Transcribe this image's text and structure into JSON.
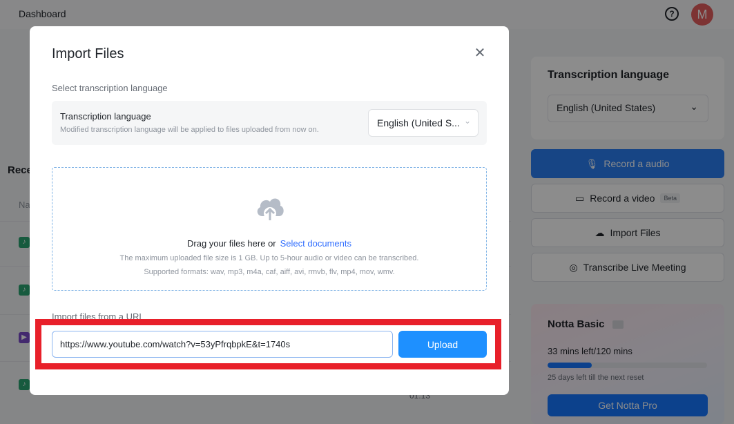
{
  "topbar": {
    "title": "Dashboard",
    "help_icon": "question-circle-icon",
    "avatar_initial": "M",
    "avatar_color": "#e35d5d"
  },
  "recent": {
    "title": "Rece",
    "column_name": "Na",
    "file_icons": [
      "audio-file-icon",
      "audio-file-icon",
      "video-file-icon",
      "audio-file-icon"
    ],
    "partial_duration": "01:13"
  },
  "sidebar": {
    "language_card": {
      "title": "Transcription language",
      "selected": "English (United States)"
    },
    "actions": [
      {
        "label": "Record a audio",
        "icon": "microphone-icon",
        "primary": true
      },
      {
        "label": "Record a video",
        "icon": "video-camera-icon",
        "badge": "Beta"
      },
      {
        "label": "Import Files",
        "icon": "cloud-upload-icon"
      },
      {
        "label": "Transcribe Live Meeting",
        "icon": "meeting-icon"
      }
    ],
    "plan": {
      "title": "Notta Basic",
      "usage_text": "33 mins left/120 mins",
      "usage_fraction": 0.275,
      "reset_text": "25 days left till the next reset",
      "cta": "Get Notta Pro"
    }
  },
  "modal": {
    "title": "Import Files",
    "close_icon": "close-icon",
    "language_section_label": "Select transcription language",
    "language_panel": {
      "title": "Transcription language",
      "description": "Modified transcription language will be applied to files uploaded from now on.",
      "selected": "English (United S..."
    },
    "dropzone": {
      "icon": "cloud-upload-icon",
      "drag_text": "Drag your files here or",
      "select_link": "Select documents",
      "limit_note": "The maximum uploaded file size is 1 GB. Up to 5-hour audio or video can be transcribed.",
      "formats_note": "Supported formats: wav, mp3, m4a, caf, aiff, avi, rmvb, flv, mp4, mov, wmv."
    },
    "url_section_label": "Import files from a URL",
    "url_input_value": "https://www.youtube.com/watch?v=53yPfrqbpkE&t=1740s",
    "upload_label": "Upload"
  },
  "colors": {
    "accent": "#1e90ff",
    "highlight": "#e8202a",
    "link": "#3370ff"
  }
}
